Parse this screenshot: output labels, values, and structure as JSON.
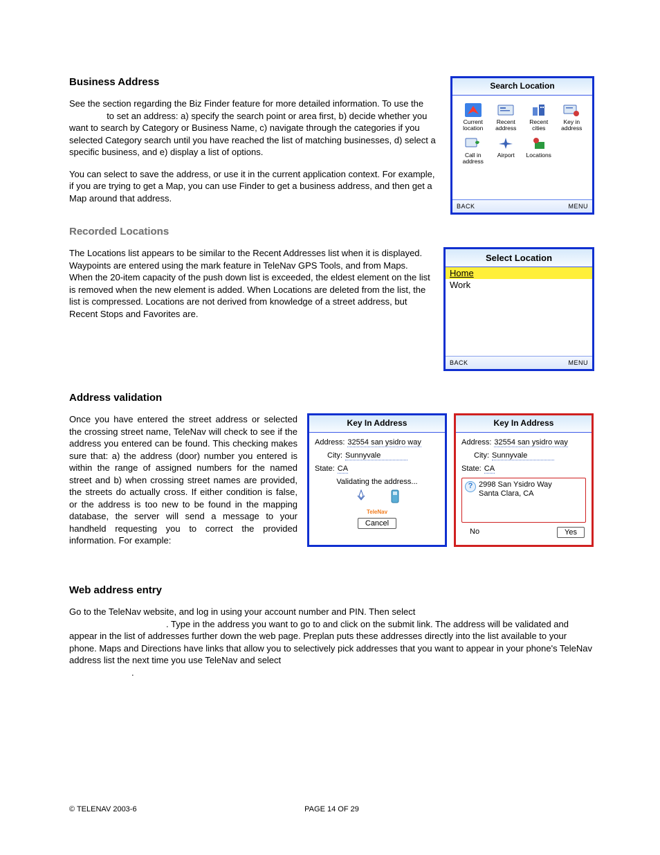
{
  "sections": {
    "biz": {
      "title": "Business Address",
      "p1a": "See the section regarding the Biz Finder feature for more detailed information. To use the ",
      "p1b": " to set an address: a) specify the search point or area first, b) decide whether you want to search by Category or Business Name, c) navigate through the categories if you selected Category search until you have reached the list of matching businesses, d) select a specific business, and e) display a list of options.",
      "p2": "You can select to save the address, or use it in the current application context. For example, if you are trying to get a Map, you can use Finder to get a business address, and then get a Map around that address."
    },
    "rec": {
      "title": "Recorded Locations",
      "p1": "The Locations list appears to be similar to the Recent Addresses list when it is displayed.  Waypoints are entered using the mark feature in TeleNav GPS Tools, and from Maps.  When the 20-item capacity of the push down list is exceeded, the eldest element on the list is removed when the new element is added.  When Locations are deleted from the list, the list is compressed.  Locations are not derived from knowledge of a street address, but Recent Stops and Favorites are."
    },
    "val": {
      "title": "Address validation",
      "p1": "Once you have entered the street address or selected the crossing street name, TeleNav will check to see if the address you entered can be found.  This checking makes sure that: a) the address (door) number you entered is within the range of assigned numbers for the named street and b) when crossing street names are provided, the streets do actually cross.  If either condition is false, or the address is too new to be found in the mapping database, the server will send a message to your handheld requesting you to correct the provided information.  For example:"
    },
    "web": {
      "title": "Web address entry",
      "p1": "Go to the TeleNav website, and log in using your account number and PIN.  Then select ",
      "p2": ".  Type in the address you want to go to and click on the submit link.  The address will be validated and appear in the list of addresses further down the web page. Preplan puts these addresses directly into the list available to your phone.  Maps and Directions have links that allow you to selectively pick addresses that you want to appear in your phone's TeleNav address list the next time you use TeleNav and select ",
      "p3": "."
    }
  },
  "search_screen": {
    "title": "Search Location",
    "icons": [
      {
        "label": "Current\nlocation"
      },
      {
        "label": "Recent\naddress"
      },
      {
        "label": "Recent\ncities"
      },
      {
        "label": "Key in\naddress"
      },
      {
        "label": "Call in\naddress"
      },
      {
        "label": "Airport"
      },
      {
        "label": "Locations"
      }
    ],
    "back": "BACK",
    "menu": "MENU"
  },
  "select_screen": {
    "title": "Select Location",
    "items": [
      "Home",
      "Work"
    ],
    "back": "BACK",
    "menu": "MENU"
  },
  "key1": {
    "title": "Key In Address",
    "addr_label": "Address:",
    "addr_value": "32554 san ysidro way",
    "city_label": "City:",
    "city_value": "Sunnyvale",
    "state_label": "State:",
    "state_value": "CA",
    "msg": "Validating the address...",
    "brand": "TeleNav",
    "cancel": "Cancel"
  },
  "key2": {
    "title": "Key In Address",
    "addr_label": "Address:",
    "addr_value": "32554 san ysidro way",
    "city_label": "City:",
    "city_value": "Sunnyvale",
    "state_label": "State:",
    "state_value": "CA",
    "suggest_line1": "2998 San Ysidro Way",
    "suggest_line2": "Santa Clara, CA",
    "no": "No",
    "yes": "Yes"
  },
  "footer": {
    "left": "© TELENAV 2003-6",
    "center": "PAGE 14 OF 29"
  }
}
